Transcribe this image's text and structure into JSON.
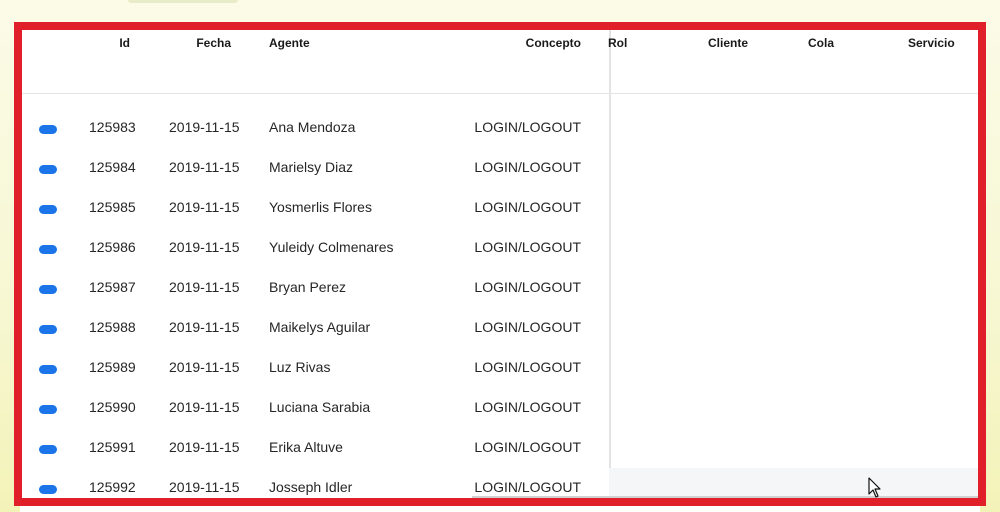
{
  "table": {
    "columns": {
      "id": "Id",
      "fecha": "Fecha",
      "agente": "Agente",
      "concepto": "Concepto",
      "rol": "Rol",
      "cliente": "Cliente",
      "cola": "Cola",
      "servicio": "Servicio"
    },
    "rows": [
      {
        "id": "125983",
        "fecha": "2019-11-15",
        "agente": "Ana Mendoza",
        "concepto": "LOGIN/LOGOUT"
      },
      {
        "id": "125984",
        "fecha": "2019-11-15",
        "agente": "Marielsy Diaz",
        "concepto": "LOGIN/LOGOUT"
      },
      {
        "id": "125985",
        "fecha": "2019-11-15",
        "agente": "Yosmerlis Flores",
        "concepto": "LOGIN/LOGOUT"
      },
      {
        "id": "125986",
        "fecha": "2019-11-15",
        "agente": "Yuleidy Colmenares",
        "concepto": "LOGIN/LOGOUT"
      },
      {
        "id": "125987",
        "fecha": "2019-11-15",
        "agente": "Bryan Perez",
        "concepto": "LOGIN/LOGOUT"
      },
      {
        "id": "125988",
        "fecha": "2019-11-15",
        "agente": "Maikelys Aguilar",
        "concepto": "LOGIN/LOGOUT"
      },
      {
        "id": "125989",
        "fecha": "2019-11-15",
        "agente": "Luz Rivas",
        "concepto": "LOGIN/LOGOUT"
      },
      {
        "id": "125990",
        "fecha": "2019-11-15",
        "agente": "Luciana Sarabia",
        "concepto": "LOGIN/LOGOUT"
      },
      {
        "id": "125991",
        "fecha": "2019-11-15",
        "agente": "Erika Altuve",
        "concepto": "LOGIN/LOGOUT"
      },
      {
        "id": "125992",
        "fecha": "2019-11-15",
        "agente": "Josseph Idler",
        "concepto": "LOGIN/LOGOUT"
      }
    ]
  },
  "colors": {
    "highlight_border": "#e11f2a",
    "row_indicator": "#1b74e8"
  }
}
